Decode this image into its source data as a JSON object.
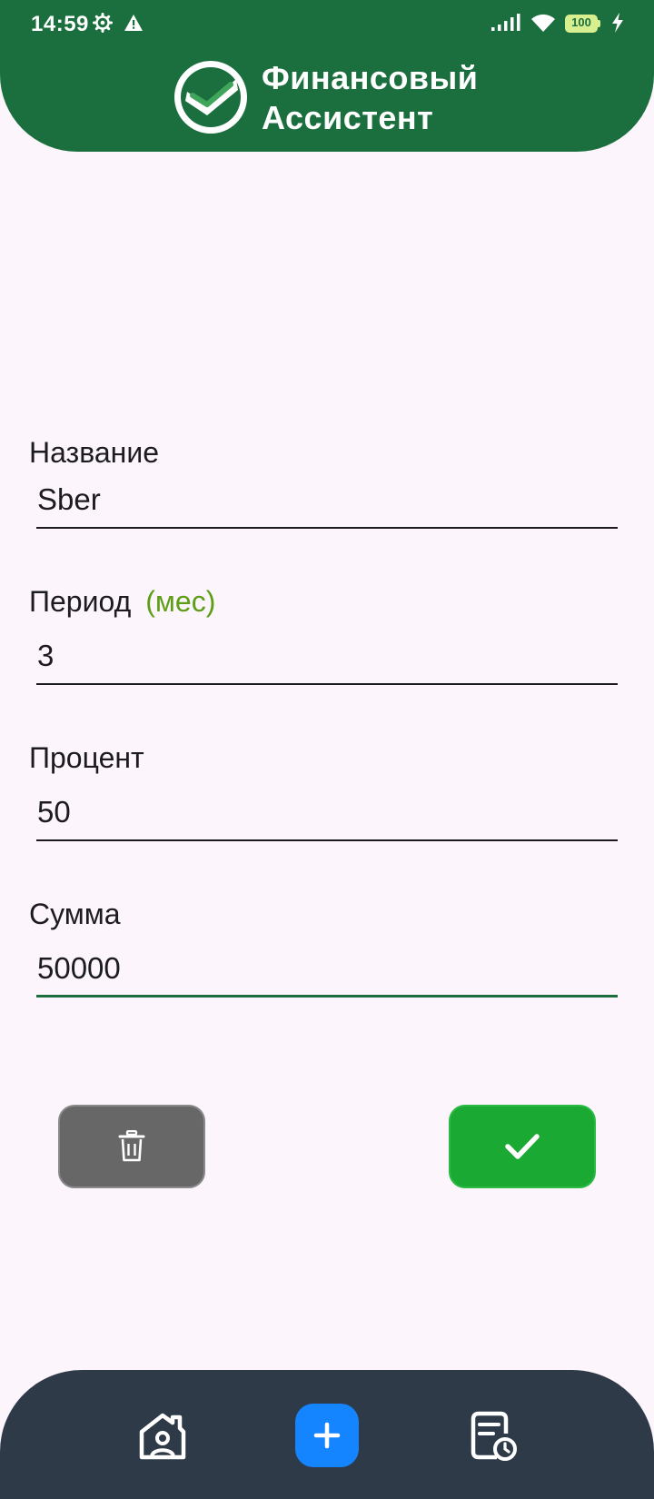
{
  "status_bar": {
    "time": "14:59",
    "battery": "100",
    "icons": [
      "gear-icon",
      "warning-icon",
      "signal-icon",
      "wifi-icon",
      "battery-icon",
      "charging-bolt-icon"
    ]
  },
  "header": {
    "title_line1": "Финансовый",
    "title_line2": "Ассистент",
    "logo_icon": "checkmark-logo-icon",
    "background": "#1b6f3e"
  },
  "form": {
    "name": {
      "label": "Название",
      "value": "Sber"
    },
    "period": {
      "label": "Период",
      "hint": "(мес)",
      "value": "3"
    },
    "percent": {
      "label": "Процент",
      "value": "50"
    },
    "amount": {
      "label": "Сумма",
      "value": "50000"
    }
  },
  "actions": {
    "delete_icon": "trash-icon",
    "confirm_icon": "checkmark-icon",
    "delete_color": "#676767",
    "confirm_color": "#1aaa33"
  },
  "bottom_nav": {
    "items": [
      {
        "icon": "home-profile-icon"
      },
      {
        "icon": "plus-icon"
      },
      {
        "icon": "history-document-icon"
      }
    ],
    "background": "#2e3a48",
    "accent": "#1485ff"
  }
}
